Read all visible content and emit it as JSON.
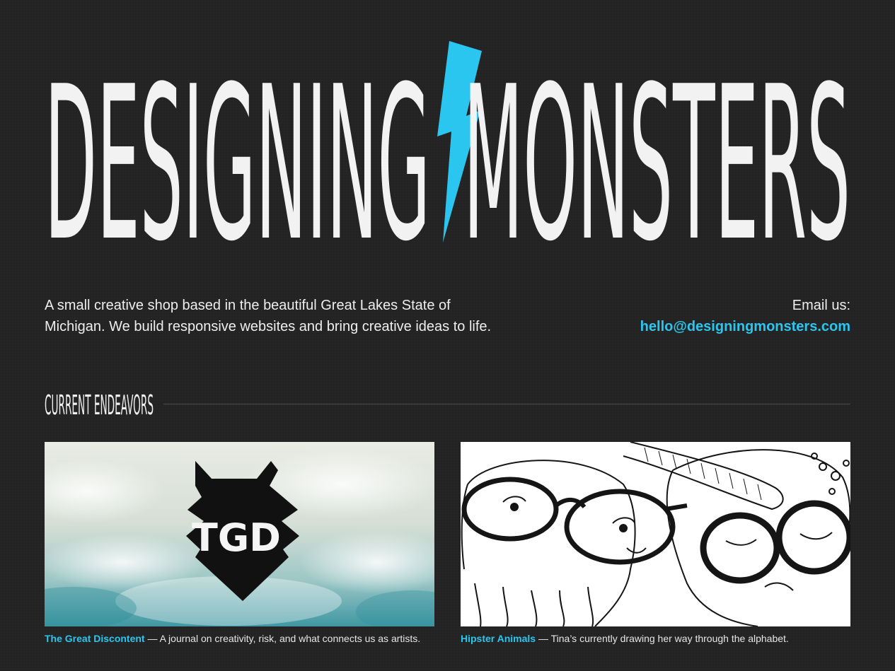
{
  "header": {
    "logo_word_left": "DESIGNING",
    "logo_word_right": "MONSTERS",
    "logo_icon": "lightning-bolt-icon",
    "accent_color": "#2bc6ef"
  },
  "intro": {
    "text": "A small creative shop based in the beautiful Great Lakes State of Michigan. We build responsive websites and bring creative ideas to life."
  },
  "contact": {
    "label": "Email us:",
    "email": "hello@designingmonsters.com"
  },
  "section": {
    "title": "CURRENT ENDEAVORS"
  },
  "projects": [
    {
      "name": "The Great Discontent",
      "description": " — A journal on creativity, risk, and what connects us as artists.",
      "image_label": "TGD"
    },
    {
      "name": "Hipster Animals",
      "description": " — Tina’s currently drawing her way through the alphabet."
    }
  ]
}
